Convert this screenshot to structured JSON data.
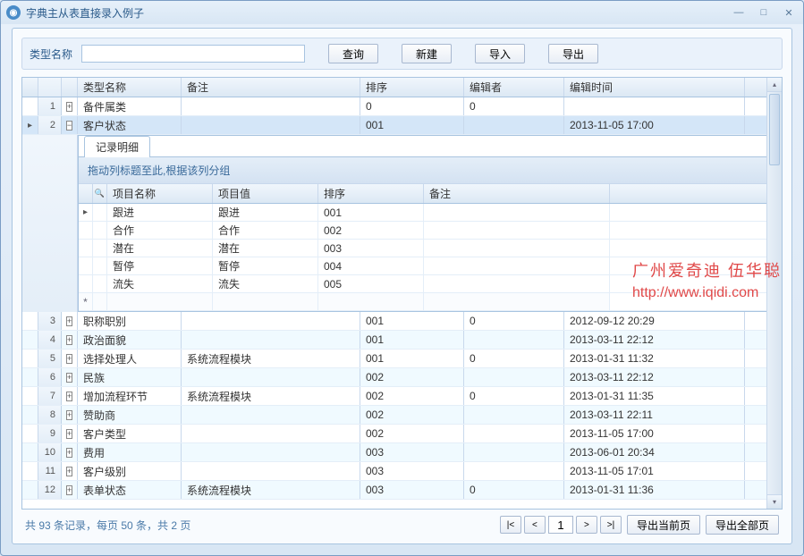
{
  "window": {
    "title": "字典主从表直接录入例子"
  },
  "search": {
    "label": "类型名称",
    "value": "",
    "buttons": {
      "query": "查询",
      "new": "新建",
      "import": "导入",
      "export": "导出"
    }
  },
  "grid": {
    "columns": {
      "name": "类型名称",
      "note": "备注",
      "sort": "排序",
      "editor": "编辑者",
      "time": "编辑时间"
    },
    "rows": [
      {
        "num": "1",
        "expanded": false,
        "indicator": "",
        "name": "备件属类",
        "note": "",
        "sort": "0",
        "editor": "0",
        "time": ""
      },
      {
        "num": "2",
        "expanded": true,
        "indicator": "arrow",
        "selected": true,
        "name": "客户状态",
        "note": "",
        "sort": "001",
        "editor": "",
        "time": "2013-11-05 17:00"
      },
      {
        "num": "3",
        "expanded": false,
        "indicator": "",
        "name": "职称职别",
        "note": "",
        "sort": "001",
        "editor": "0",
        "time": "2012-09-12 20:29"
      },
      {
        "num": "4",
        "expanded": false,
        "indicator": "",
        "name": "政治面貌",
        "note": "",
        "sort": "001",
        "editor": "",
        "time": "2013-03-11 22:12"
      },
      {
        "num": "5",
        "expanded": false,
        "indicator": "",
        "name": "选择处理人",
        "note": "系统流程模块",
        "sort": "001",
        "editor": "0",
        "time": "2013-01-31 11:32"
      },
      {
        "num": "6",
        "expanded": false,
        "indicator": "",
        "name": "民族",
        "note": "",
        "sort": "002",
        "editor": "",
        "time": "2013-03-11 22:12"
      },
      {
        "num": "7",
        "expanded": false,
        "indicator": "",
        "name": "增加流程环节",
        "note": "系统流程模块",
        "sort": "002",
        "editor": "0",
        "time": "2013-01-31 11:35"
      },
      {
        "num": "8",
        "expanded": false,
        "indicator": "",
        "name": "赞助商",
        "note": "",
        "sort": "002",
        "editor": "",
        "time": "2013-03-11 22:11"
      },
      {
        "num": "9",
        "expanded": false,
        "indicator": "",
        "name": "客户类型",
        "note": "",
        "sort": "002",
        "editor": "",
        "time": "2013-11-05 17:00"
      },
      {
        "num": "10",
        "expanded": false,
        "indicator": "",
        "name": "费用",
        "note": "",
        "sort": "003",
        "editor": "",
        "time": "2013-06-01 20:34"
      },
      {
        "num": "11",
        "expanded": false,
        "indicator": "",
        "name": "客户级别",
        "note": "",
        "sort": "003",
        "editor": "",
        "time": "2013-11-05 17:01"
      },
      {
        "num": "12",
        "expanded": false,
        "indicator": "",
        "name": "表单状态",
        "note": "系统流程模块",
        "sort": "003",
        "editor": "0",
        "time": "2013-01-31 11:36"
      }
    ]
  },
  "detail": {
    "tab": "记录明细",
    "grouphint": "拖动列标题至此,根据该列分组",
    "columns": {
      "name": "项目名称",
      "value": "项目值",
      "sort": "排序",
      "note": "备注"
    },
    "rows": [
      {
        "indicator": "arrow",
        "name": "跟进",
        "value": "跟进",
        "sort": "001",
        "note": ""
      },
      {
        "indicator": "",
        "name": "合作",
        "value": "合作",
        "sort": "002",
        "note": ""
      },
      {
        "indicator": "",
        "name": "潜在",
        "value": "潜在",
        "sort": "003",
        "note": ""
      },
      {
        "indicator": "",
        "name": "暂停",
        "value": "暂停",
        "sort": "004",
        "note": ""
      },
      {
        "indicator": "",
        "name": "流失",
        "value": "流失",
        "sort": "005",
        "note": ""
      }
    ]
  },
  "watermark": {
    "line1": "广州爱奇迪 伍华聪",
    "line2": "http://www.iqidi.com"
  },
  "footer": {
    "status": "共 93 条记录，每页 50 条，共 2 页",
    "page": "1",
    "export_current": "导出当前页",
    "export_all": "导出全部页"
  }
}
